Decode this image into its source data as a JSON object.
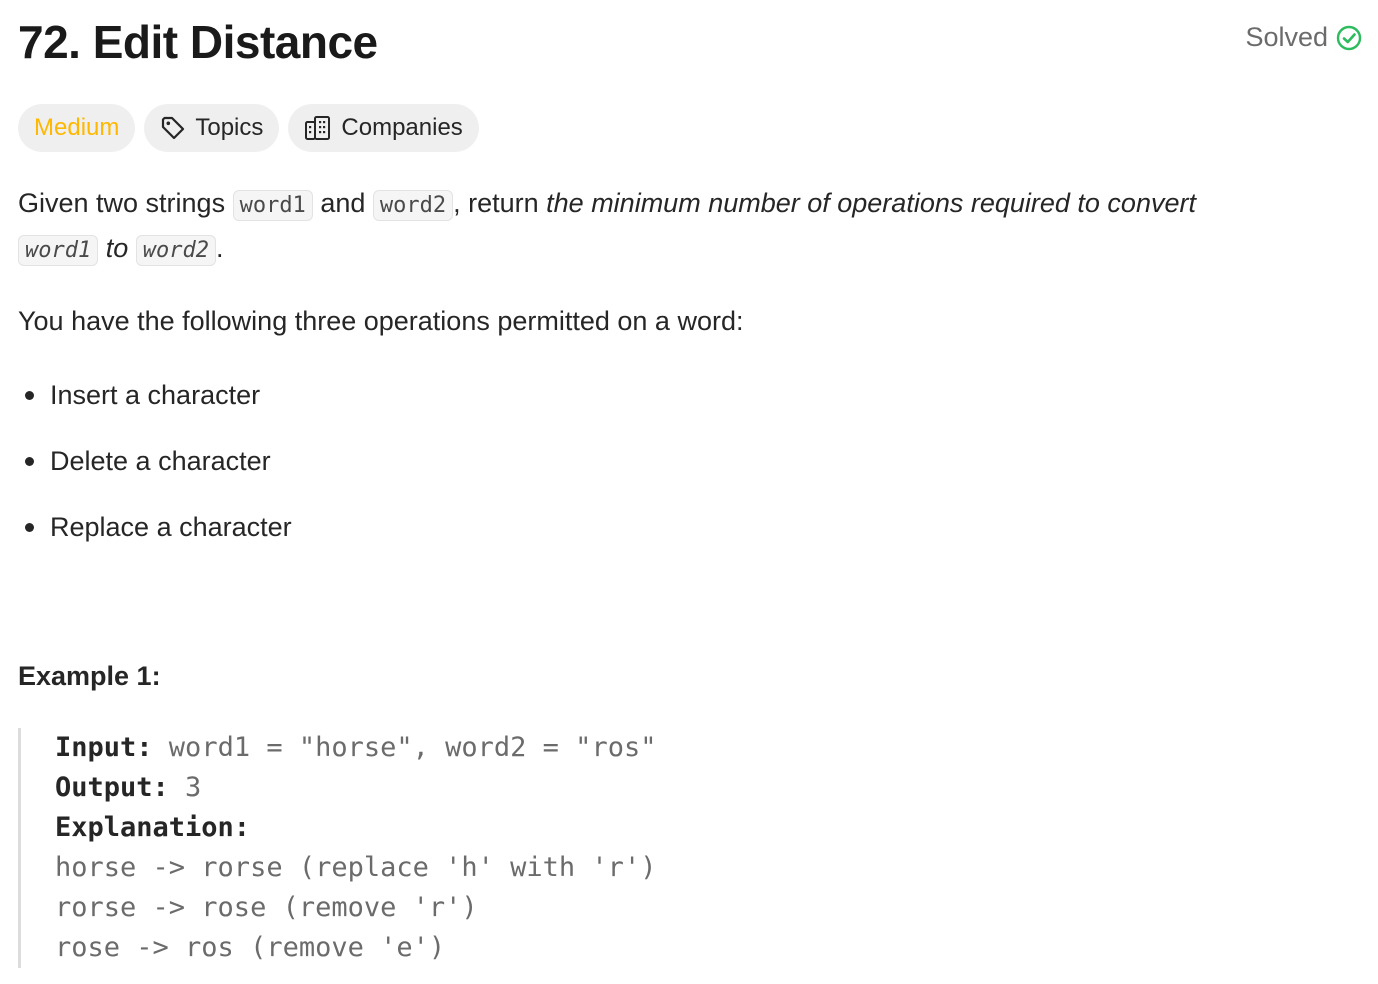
{
  "problem": {
    "title": "72. Edit Distance",
    "status": "Solved",
    "status_color": "#2cbb5d"
  },
  "tags": {
    "difficulty": "Medium",
    "difficulty_color": "#ffb800",
    "topics": "Topics",
    "companies": "Companies"
  },
  "description": {
    "p1_given": "Given two strings ",
    "p1_word1": "word1",
    "p1_and": " and ",
    "p1_word2": "word2",
    "p1_return": ", return ",
    "p1_em": "the minimum number of operations required to convert",
    "p1_line2_word1": "word1",
    "p1_line2_to": " to ",
    "p1_line2_word2": "word2",
    "p1_period": ".",
    "ops_intro": "You have the following three operations permitted on a word:",
    "operations": [
      "Insert a character",
      "Delete a character",
      "Replace a character"
    ]
  },
  "example1": {
    "title": "Example 1:",
    "input_label": "Input:",
    "input_value": " word1 = \"horse\", word2 = \"ros\"",
    "output_label": "Output:",
    "output_value": " 3",
    "explanation_label": "Explanation:",
    "explanation_lines": [
      "horse -> rorse (replace 'h' with 'r')",
      "rorse -> rose (remove 'r')",
      "rose -> ros (remove 'e')"
    ]
  },
  "icons": {
    "solved": "check-circle-icon",
    "topics": "tag-icon",
    "companies": "building-icon"
  }
}
